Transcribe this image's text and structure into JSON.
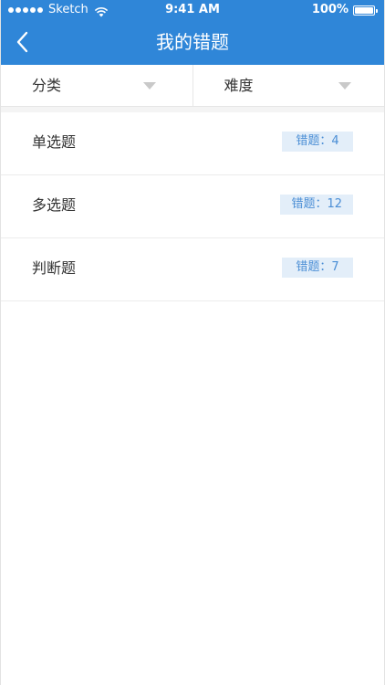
{
  "status_bar": {
    "carrier": "Sketch",
    "time": "9:41 AM",
    "battery": "100%"
  },
  "navbar": {
    "title": "我的错题",
    "back_icon": "chevron-left-icon"
  },
  "filters": [
    {
      "label": "分类",
      "icon": "caret-down-icon"
    },
    {
      "label": "难度",
      "icon": "caret-down-icon"
    }
  ],
  "list": [
    {
      "label": "单选题",
      "badge": "错题：4"
    },
    {
      "label": "多选题",
      "badge": "错题：12"
    },
    {
      "label": "判断题",
      "badge": "错题：7"
    }
  ],
  "colors": {
    "header_bg": "#2f86d8",
    "badge_bg": "#e3eef9",
    "badge_text": "#4a8ed5"
  }
}
